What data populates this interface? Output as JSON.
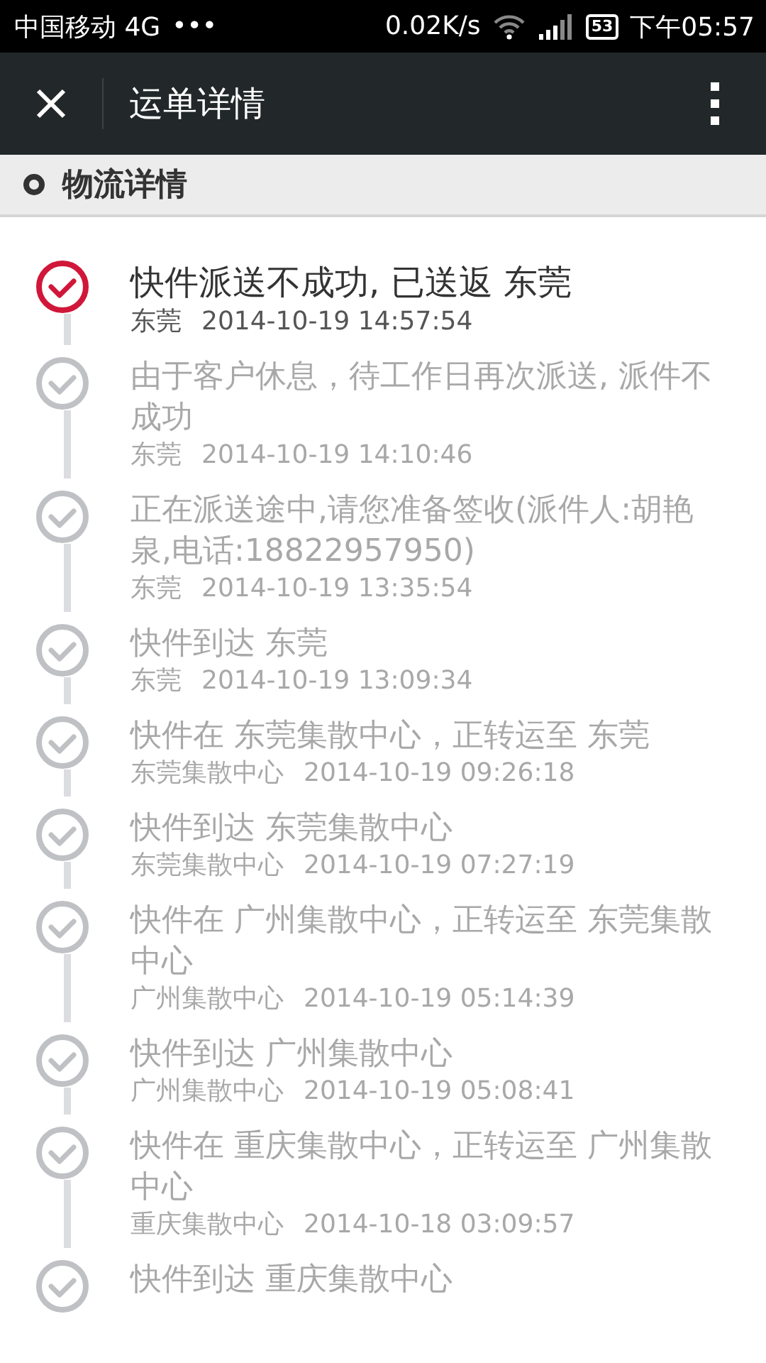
{
  "status_bar": {
    "carrier": "中国移动 4G",
    "dots": "•••",
    "speed": "0.02K/s",
    "battery": "53",
    "time": "下午05:57"
  },
  "header": {
    "title": "运单详情"
  },
  "section": {
    "title": "物流详情"
  },
  "events": [
    {
      "description": "快件派送不成功, 已送返 东莞",
      "location": "东莞",
      "time": "2014-10-19 14:57:54",
      "current": true,
      "color": "#d0173a"
    },
    {
      "description": "由于客户休息，待工作日再次派送, 派件不成功",
      "location": "东莞",
      "time": "2014-10-19 14:10:46",
      "current": false
    },
    {
      "description": "正在派送途中,请您准备签收(派件人:胡艳泉,电话:18822957950)",
      "location": "东莞",
      "time": "2014-10-19 13:35:54",
      "current": false
    },
    {
      "description": "快件到达 东莞",
      "location": "东莞",
      "time": "2014-10-19 13:09:34",
      "current": false
    },
    {
      "description": "快件在 东莞集散中心，正转运至 东莞",
      "location": "东莞集散中心",
      "time": "2014-10-19 09:26:18",
      "current": false
    },
    {
      "description": "快件到达 东莞集散中心",
      "location": "东莞集散中心",
      "time": "2014-10-19 07:27:19",
      "current": false
    },
    {
      "description": "快件在 广州集散中心，正转运至 东莞集散中心",
      "location": "广州集散中心",
      "time": "2014-10-19 05:14:39",
      "current": false
    },
    {
      "description": "快件到达 广州集散中心",
      "location": "广州集散中心",
      "time": "2014-10-19 05:08:41",
      "current": false
    },
    {
      "description": "快件在 重庆集散中心，正转运至 广州集散中心",
      "location": "重庆集散中心",
      "time": "2014-10-18 03:09:57",
      "current": false
    },
    {
      "description": "快件到达 重庆集散中心",
      "current": false
    }
  ]
}
